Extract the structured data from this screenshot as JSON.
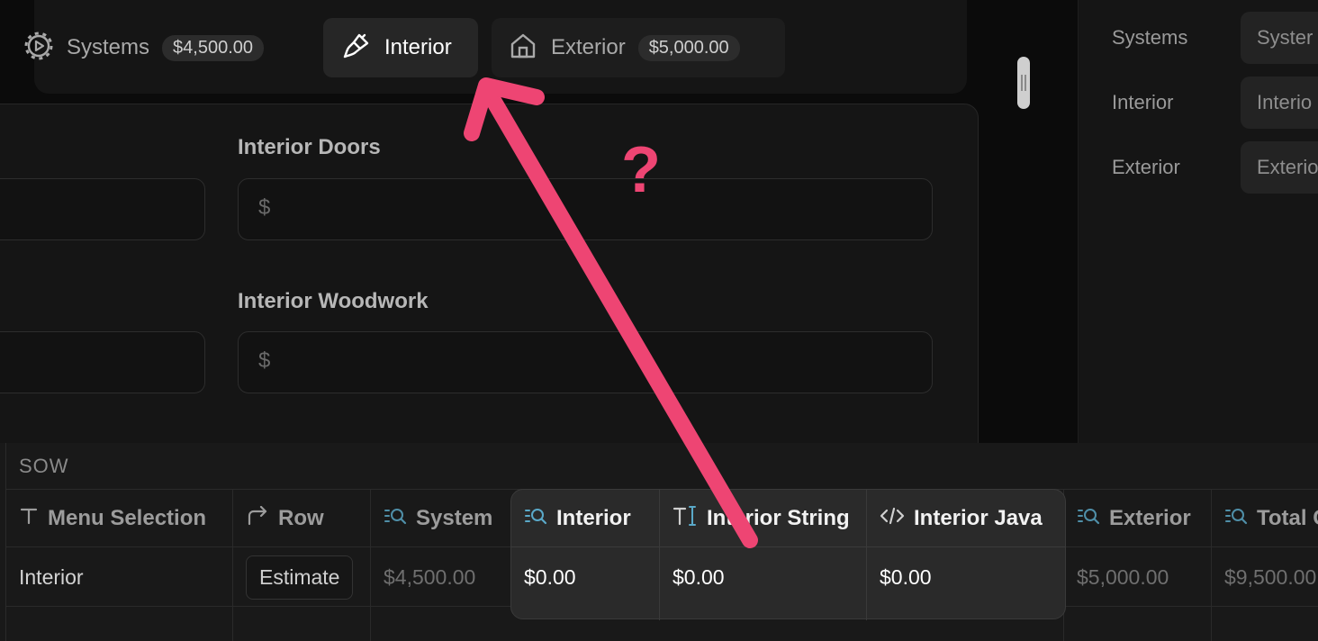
{
  "tabs": {
    "systems": {
      "label": "Systems",
      "badge": "$4,500.00"
    },
    "interior": {
      "label": "Interior"
    },
    "exterior": {
      "label": "Exterior",
      "badge": "$5,000.00"
    }
  },
  "form": {
    "fields": [
      {
        "label": "Interior Doors",
        "currency": "$"
      },
      {
        "label": "Interior Woodwork",
        "currency": "$"
      }
    ]
  },
  "right_panel": {
    "rows": [
      {
        "label": "Systems",
        "value": "Syster"
      },
      {
        "label": "Interior",
        "value": "Interio"
      },
      {
        "label": "Exterior",
        "value": "Exterio"
      }
    ]
  },
  "table": {
    "group": "SOW",
    "columns": [
      {
        "name": "Menu Selection",
        "value": "Interior"
      },
      {
        "name": "Row",
        "value": "Estimate"
      },
      {
        "name": "System",
        "value": "$4,500.00"
      },
      {
        "name": "Interior",
        "value": "$0.00"
      },
      {
        "name": "Interior String",
        "value": "$0.00"
      },
      {
        "name": "Interior Java",
        "value": "$0.00"
      },
      {
        "name": "Exterior",
        "value": "$5,000.00"
      },
      {
        "name": "Total C",
        "value": "$9,500.00"
      }
    ]
  },
  "annotation": {
    "text": "?",
    "color": "#ee4573"
  },
  "colors": {
    "background": "#0b0b0b",
    "panel": "#151515",
    "accent": "#ee4573",
    "icon_blue": "#5aa9c9"
  }
}
